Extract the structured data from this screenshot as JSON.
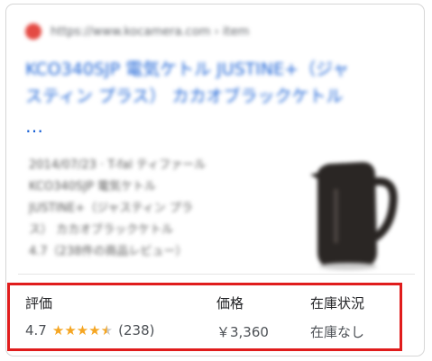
{
  "result": {
    "source_url": "https://www.kocamera.com › item",
    "title_line1": "KCO340SJP 電気ケトル JUSTINE+（ジャ",
    "title_line2": "スティン プラス） カカオブラックケトル",
    "title_more": "…",
    "snippet": [
      "2014/07/23 · T-fal ティファール",
      "KCO340SJP 電気ケトル",
      "JUSTINE+（ジャスティン プラ",
      "ス） カカオブラックケトル",
      "4.7（238件の商品レビュー）"
    ]
  },
  "product_info": {
    "rating_header": "評価",
    "price_header": "価格",
    "stock_header": "在庫状況",
    "rating_value": "4.7",
    "rating_stars": 4.7,
    "review_count": "(238)",
    "price": "￥3,360",
    "stock_status": "在庫なし"
  },
  "colors": {
    "link": "#1a62d6",
    "star": "#f5a623",
    "highlight_border": "#e01c1c"
  }
}
